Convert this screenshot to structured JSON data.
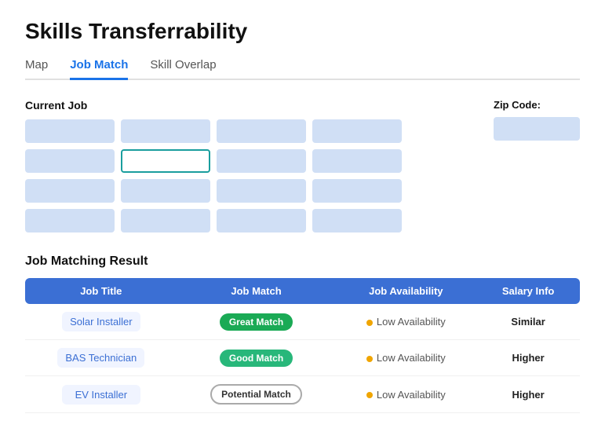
{
  "page": {
    "title": "Skills Transferrability"
  },
  "tabs": [
    {
      "id": "map",
      "label": "Map",
      "active": false
    },
    {
      "id": "job-match",
      "label": "Job Match",
      "active": true
    },
    {
      "id": "skill-overlap",
      "label": "Skill Overlap",
      "active": false
    }
  ],
  "currentJob": {
    "label": "Current Job",
    "grid": [
      [
        false,
        false,
        false,
        false
      ],
      [
        false,
        true,
        false,
        false
      ],
      [
        false,
        false,
        false,
        false
      ],
      [
        false,
        false,
        false,
        false
      ]
    ]
  },
  "zipCode": {
    "label": "Zip Code:"
  },
  "results": {
    "sectionTitle": "Job Matching Result",
    "columns": [
      "Job Title",
      "Job Match",
      "Job Availability",
      "Salary Info"
    ],
    "rows": [
      {
        "jobTitle": "Solar Installer",
        "jobMatch": "Great Match",
        "jobMatchType": "great",
        "availability": "Low Availability",
        "salary": "Similar"
      },
      {
        "jobTitle": "BAS Technician",
        "jobMatch": "Good Match",
        "jobMatchType": "good",
        "availability": "Low Availability",
        "salary": "Higher"
      },
      {
        "jobTitle": "EV Installer",
        "jobMatch": "Potential Match",
        "jobMatchType": "potential",
        "availability": "Low Availability",
        "salary": "Higher"
      }
    ]
  }
}
